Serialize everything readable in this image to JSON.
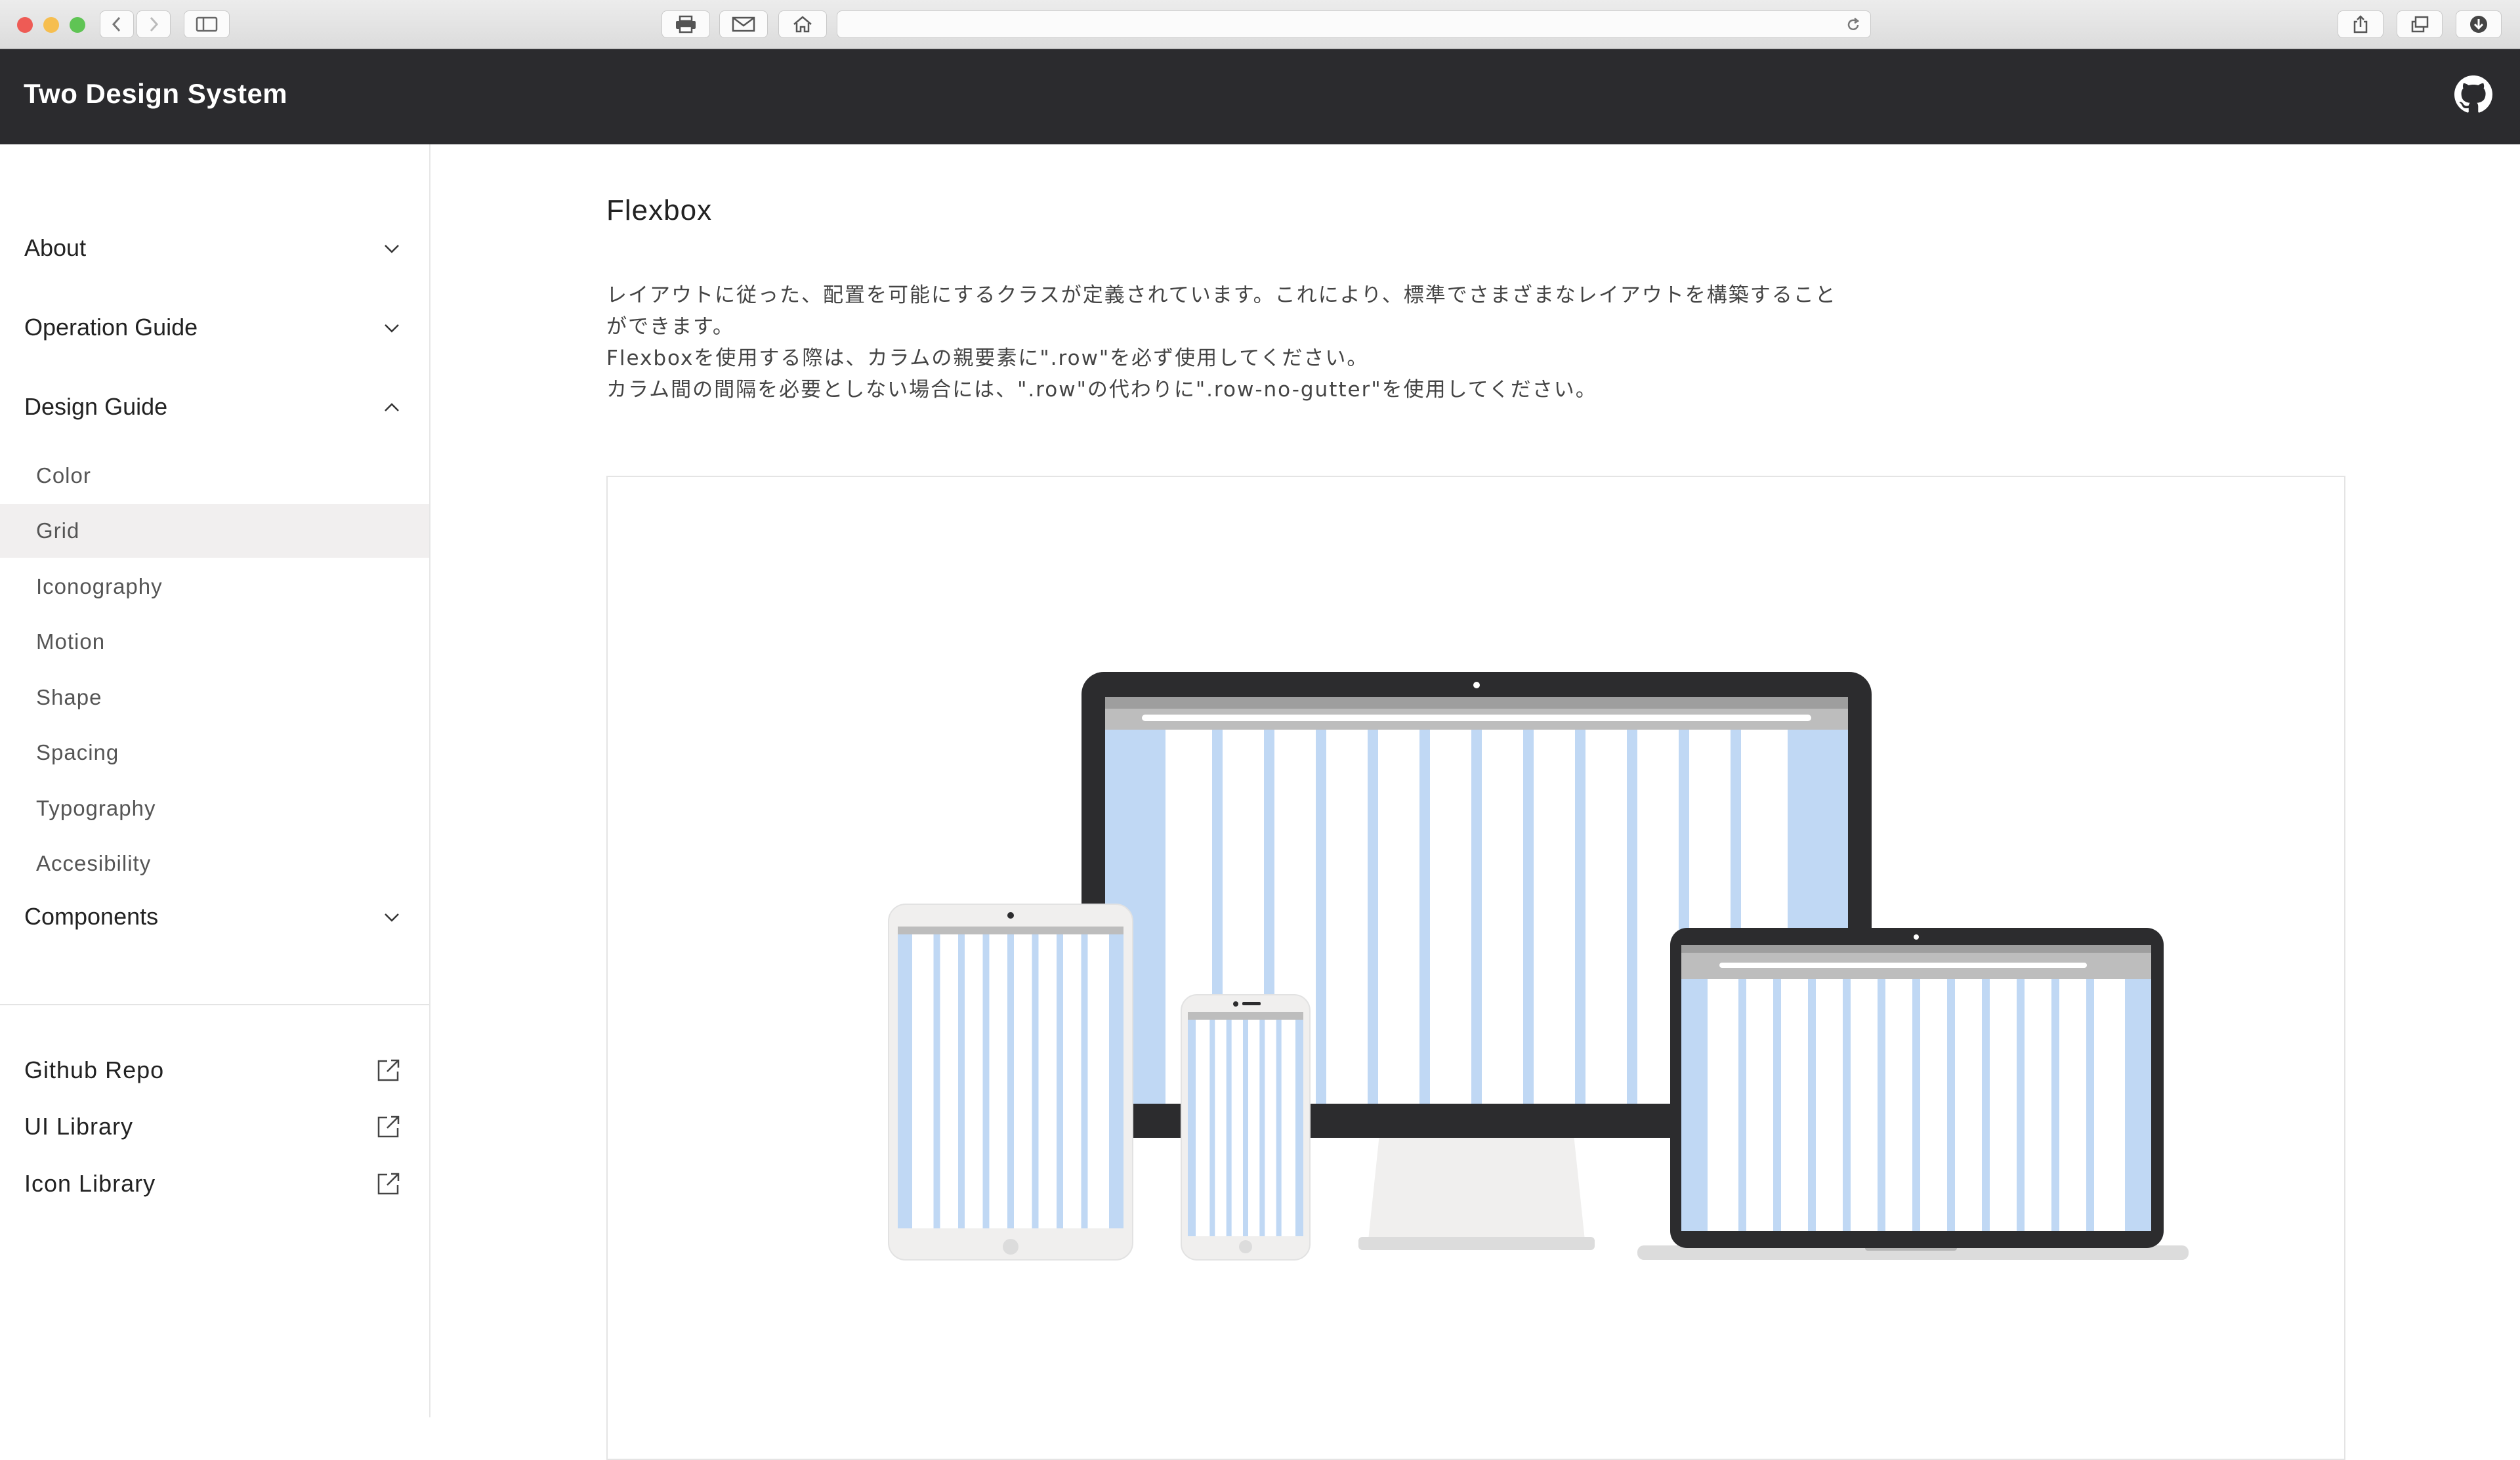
{
  "browser": {
    "address": ""
  },
  "header": {
    "brand": "Two Design System"
  },
  "sidebar": {
    "sections": [
      {
        "label": "About",
        "expanded": false
      },
      {
        "label": "Operation Guide",
        "expanded": false
      },
      {
        "label": "Design Guide",
        "expanded": true
      },
      {
        "label": "Components",
        "expanded": false
      }
    ],
    "design_guide_items": [
      {
        "label": "Color"
      },
      {
        "label": "Grid",
        "active": true
      },
      {
        "label": "Iconography"
      },
      {
        "label": "Motion"
      },
      {
        "label": "Shape"
      },
      {
        "label": "Spacing"
      },
      {
        "label": "Typography"
      },
      {
        "label": "Accesibility"
      }
    ],
    "links": [
      {
        "label": "Github Repo"
      },
      {
        "label": "UI Library"
      },
      {
        "label": "Icon Library"
      }
    ]
  },
  "main": {
    "title": "Flexbox",
    "description": [
      "レイアウトに従った、配置を可能にするクラスが定義されています。これにより、標準でさまざまなレイアウトを構築すること",
      "ができます。",
      "Flexboxを使用する際は、カラムの親要素に\".row\"を必ず使用してください。",
      "カラム間の間隔を必要としない場合には、\".row\"の代わりに\".row-no-gutter\"を使用してください。"
    ]
  },
  "colors": {
    "header_bg": "#2b2b2e",
    "active_item_bg": "#f1efef",
    "grid_column": "#c0d8f4",
    "device_dark": "#2c2c2e",
    "device_light": "#f0efee"
  }
}
